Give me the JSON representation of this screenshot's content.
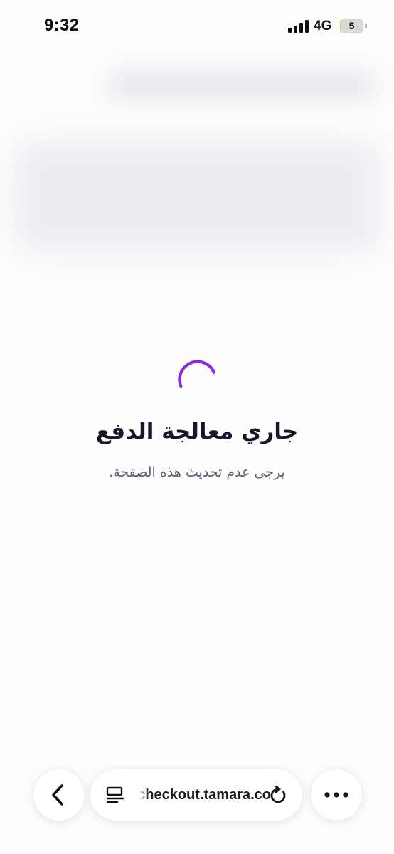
{
  "status_bar": {
    "time": "9:32",
    "network": "4G",
    "battery_level": "5",
    "battery_fraction": 0.05,
    "signal_bars": 4
  },
  "loading": {
    "title": "جاري معالجة الدفع",
    "subtitle": "يرجى عدم تحديث هذه الصفحة.",
    "spinner_color": "#8a2be2"
  },
  "browser": {
    "url": "checkout.tamara.co",
    "back_icon": "chevron-left-icon",
    "reader_icon": "reader-icon",
    "reload_icon": "reload-icon",
    "more_icon": "ellipsis-icon"
  }
}
